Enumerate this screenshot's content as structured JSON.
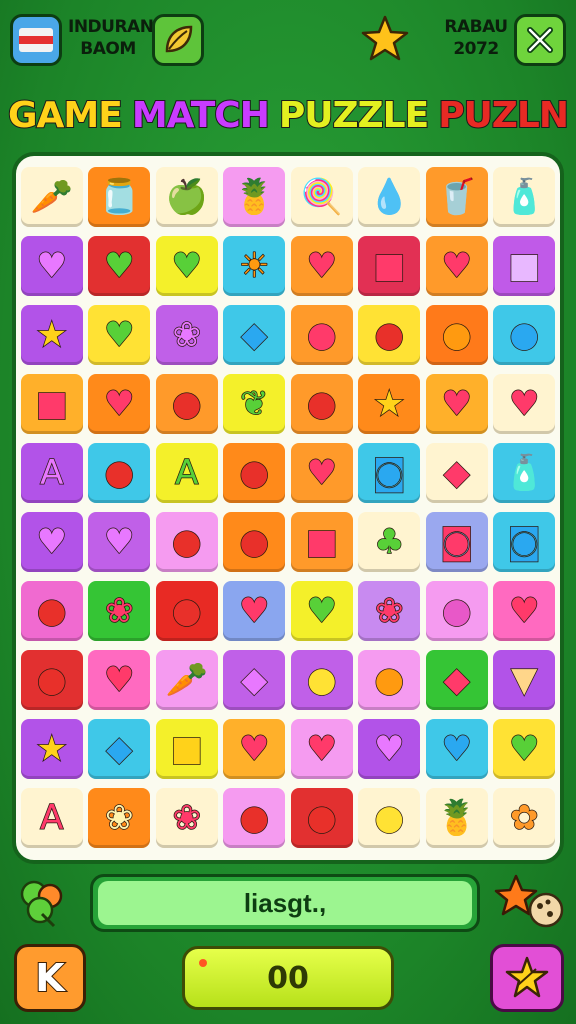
{
  "header": {
    "left_text_line1": "INDURAN",
    "left_text_line2": "BAOM",
    "right_text_line1": "RABAU",
    "right_text_line2": "2072",
    "flag_icon": "flag-icon",
    "leaf_icon": "leaf-icon",
    "star_icon": "star-icon",
    "close_icon": "close-icon"
  },
  "title": {
    "words": [
      {
        "text": "GAME",
        "color": "#ffd21a"
      },
      {
        "text": "MATCH",
        "color": "#c93bff"
      },
      {
        "text": "PUZZLE",
        "color": "#e4f020"
      },
      {
        "text": "PUZLN",
        "color": "#e82a24"
      }
    ]
  },
  "board": {
    "columns": 8,
    "rows": 10,
    "tiles": [
      [
        "carrot",
        "tomato-jar",
        "green-apple",
        "pineapple",
        "lollipop",
        "blue-gem",
        "drink-cup",
        "bottle"
      ],
      [
        "heart",
        "heart",
        "heart",
        "sun",
        "heart",
        "square-gem",
        "heart",
        "candy"
      ],
      [
        "star",
        "heart",
        "grapes",
        "ice-cube",
        "drop",
        "apple",
        "orange",
        "drop"
      ],
      [
        "square-gem",
        "heart",
        "apple",
        "leaf",
        "apple",
        "star",
        "heart",
        "heart"
      ],
      [
        "letter",
        "apple",
        "letter",
        "apple",
        "heart",
        "jar",
        "fish",
        "bottle"
      ],
      [
        "heart",
        "heart",
        "apple",
        "apple",
        "square-gem",
        "broccoli",
        "jar",
        "jar"
      ],
      [
        "strawberry",
        "grapes",
        "apple",
        "heart",
        "heart",
        "grapes",
        "plum",
        "heart"
      ],
      [
        "apple",
        "heart",
        "carrot",
        "fish",
        "corn",
        "orange",
        "fish",
        "ice-cream"
      ],
      [
        "star",
        "fish",
        "cheese",
        "heart",
        "heart",
        "heart",
        "heart",
        "heart"
      ],
      [
        "letter",
        "popcorn",
        "grapes",
        "strawberry",
        "apple",
        "pear",
        "pineapple",
        "cookie"
      ]
    ],
    "tile_colors": [
      [
        "#fff4d0",
        "#ff8a1a",
        "#fff4d0",
        "#f59bf0",
        "#fff4d0",
        "#fff4d0",
        "#ff9a2a",
        "#fff4d0"
      ],
      [
        "#b253e8",
        "#e23030",
        "#f4f02a",
        "#3fc8e8",
        "#ff9a2a",
        "#e23054",
        "#ff9a2a",
        "#c05ae8"
      ],
      [
        "#b253e8",
        "#ffe234",
        "#c060e8",
        "#3fc8e8",
        "#ff9a2a",
        "#ffe234",
        "#ff7a1a",
        "#3fc8e8"
      ],
      [
        "#ffb02a",
        "#ff8a1a",
        "#ff9a2a",
        "#f4f02a",
        "#ff9a2a",
        "#ff8a1a",
        "#ffb02a",
        "#fff4d0"
      ],
      [
        "#b253e8",
        "#3fc8e8",
        "#f4f02a",
        "#ff8a1a",
        "#ff9a2a",
        "#3fc8e8",
        "#fff4d0",
        "#3fc8e8"
      ],
      [
        "#b253e8",
        "#c060e8",
        "#f59bf0",
        "#ff8a1a",
        "#ff9a2a",
        "#fff4d0",
        "#9aa8ef",
        "#3fc8e8"
      ],
      [
        "#f06ad0",
        "#35c535",
        "#e82a24",
        "#8aa6ef",
        "#f4f02a",
        "#c88af0",
        "#f59bf0",
        "#ff6ac0"
      ],
      [
        "#e23030",
        "#ff6ac0",
        "#f59bf0",
        "#c060e8",
        "#c060e8",
        "#f59bf0",
        "#35c535",
        "#b253e8"
      ],
      [
        "#b253e8",
        "#3fc8e8",
        "#f4f02a",
        "#ffb02a",
        "#f59bf0",
        "#b253e8",
        "#3fc8e8",
        "#ffe234"
      ],
      [
        "#fff4d0",
        "#ff8a1a",
        "#fff4d0",
        "#f59bf0",
        "#e23030",
        "#fff4d0",
        "#fff4d0",
        "#fff4d0"
      ]
    ]
  },
  "status": {
    "message": "liasgt.,",
    "clover_icon": "clover-icon",
    "star_cookie_icon": "star-cookie-icon"
  },
  "controls": {
    "left_button_label": "K",
    "score": "00",
    "right_icon": "star-icon"
  }
}
